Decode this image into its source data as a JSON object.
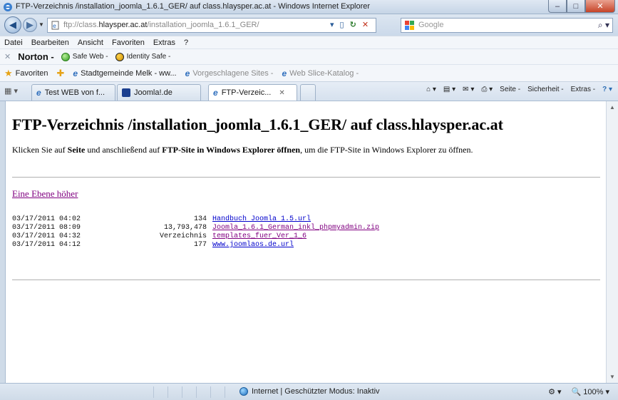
{
  "window": {
    "title": "FTP-Verzeichnis /installation_joomla_1.6.1_GER/ auf class.hlaysper.ac.at - Windows Internet Explorer"
  },
  "address": {
    "url_prefix": "ftp://class.",
    "url_host": "hlaysper.ac.at",
    "url_path": "/installation_joomla_1.6.1_GER/"
  },
  "search": {
    "placeholder": "Google"
  },
  "menu": [
    "Datei",
    "Bearbeiten",
    "Ansicht",
    "Favoriten",
    "Extras",
    "?"
  ],
  "norton": {
    "brand": "Norton -",
    "safe_web": "Safe Web -",
    "identity_safe": "Identity Safe -"
  },
  "favorites": {
    "label": "Favoriten",
    "items": [
      {
        "label": "Stadtgemeinde Melk - ww...",
        "dim": false
      },
      {
        "label": "Vorgeschlagene Sites -",
        "dim": true
      },
      {
        "label": "Web Slice-Katalog -",
        "dim": true
      }
    ]
  },
  "tabs": [
    {
      "label": "Test WEB von f...",
      "active": false
    },
    {
      "label": "Joomla!.de",
      "active": false
    },
    {
      "label": "FTP-Verzeic...",
      "active": true
    }
  ],
  "commandbar": {
    "seite": "Seite -",
    "sicherheit": "Sicherheit -",
    "extras": "Extras -"
  },
  "page": {
    "heading": "FTP-Verzeichnis /installation_joomla_1.6.1_GER/ auf class.hlaysper.ac.at",
    "intro_1": "Klicken Sie auf ",
    "intro_b1": "Seite",
    "intro_2": " und anschließend auf ",
    "intro_b2": "FTP-Site in Windows Explorer öffnen",
    "intro_3": ", um die FTP-Site in Windows Explorer zu öffnen.",
    "up_link": "Eine Ebene höher",
    "entries": [
      {
        "date": "03/17/2011 04:02",
        "size": "134",
        "name": "Handbuch Joomla 1.5.url",
        "visited": false
      },
      {
        "date": "03/17/2011 08:09",
        "size": "13,793,478",
        "name": "Joomla_1.6.1_German_inkl_phpmyadmin.zip",
        "visited": true
      },
      {
        "date": "03/17/2011 04:32",
        "size": "Verzeichnis",
        "name": "templates_fuer_Ver_1_6",
        "visited": true
      },
      {
        "date": "03/17/2011 04:12",
        "size": "177",
        "name": "www.joomlaos.de.url",
        "visited": false
      }
    ]
  },
  "status": {
    "zone": "Internet | Geschützter Modus: Inaktiv",
    "zoom": "100%"
  }
}
